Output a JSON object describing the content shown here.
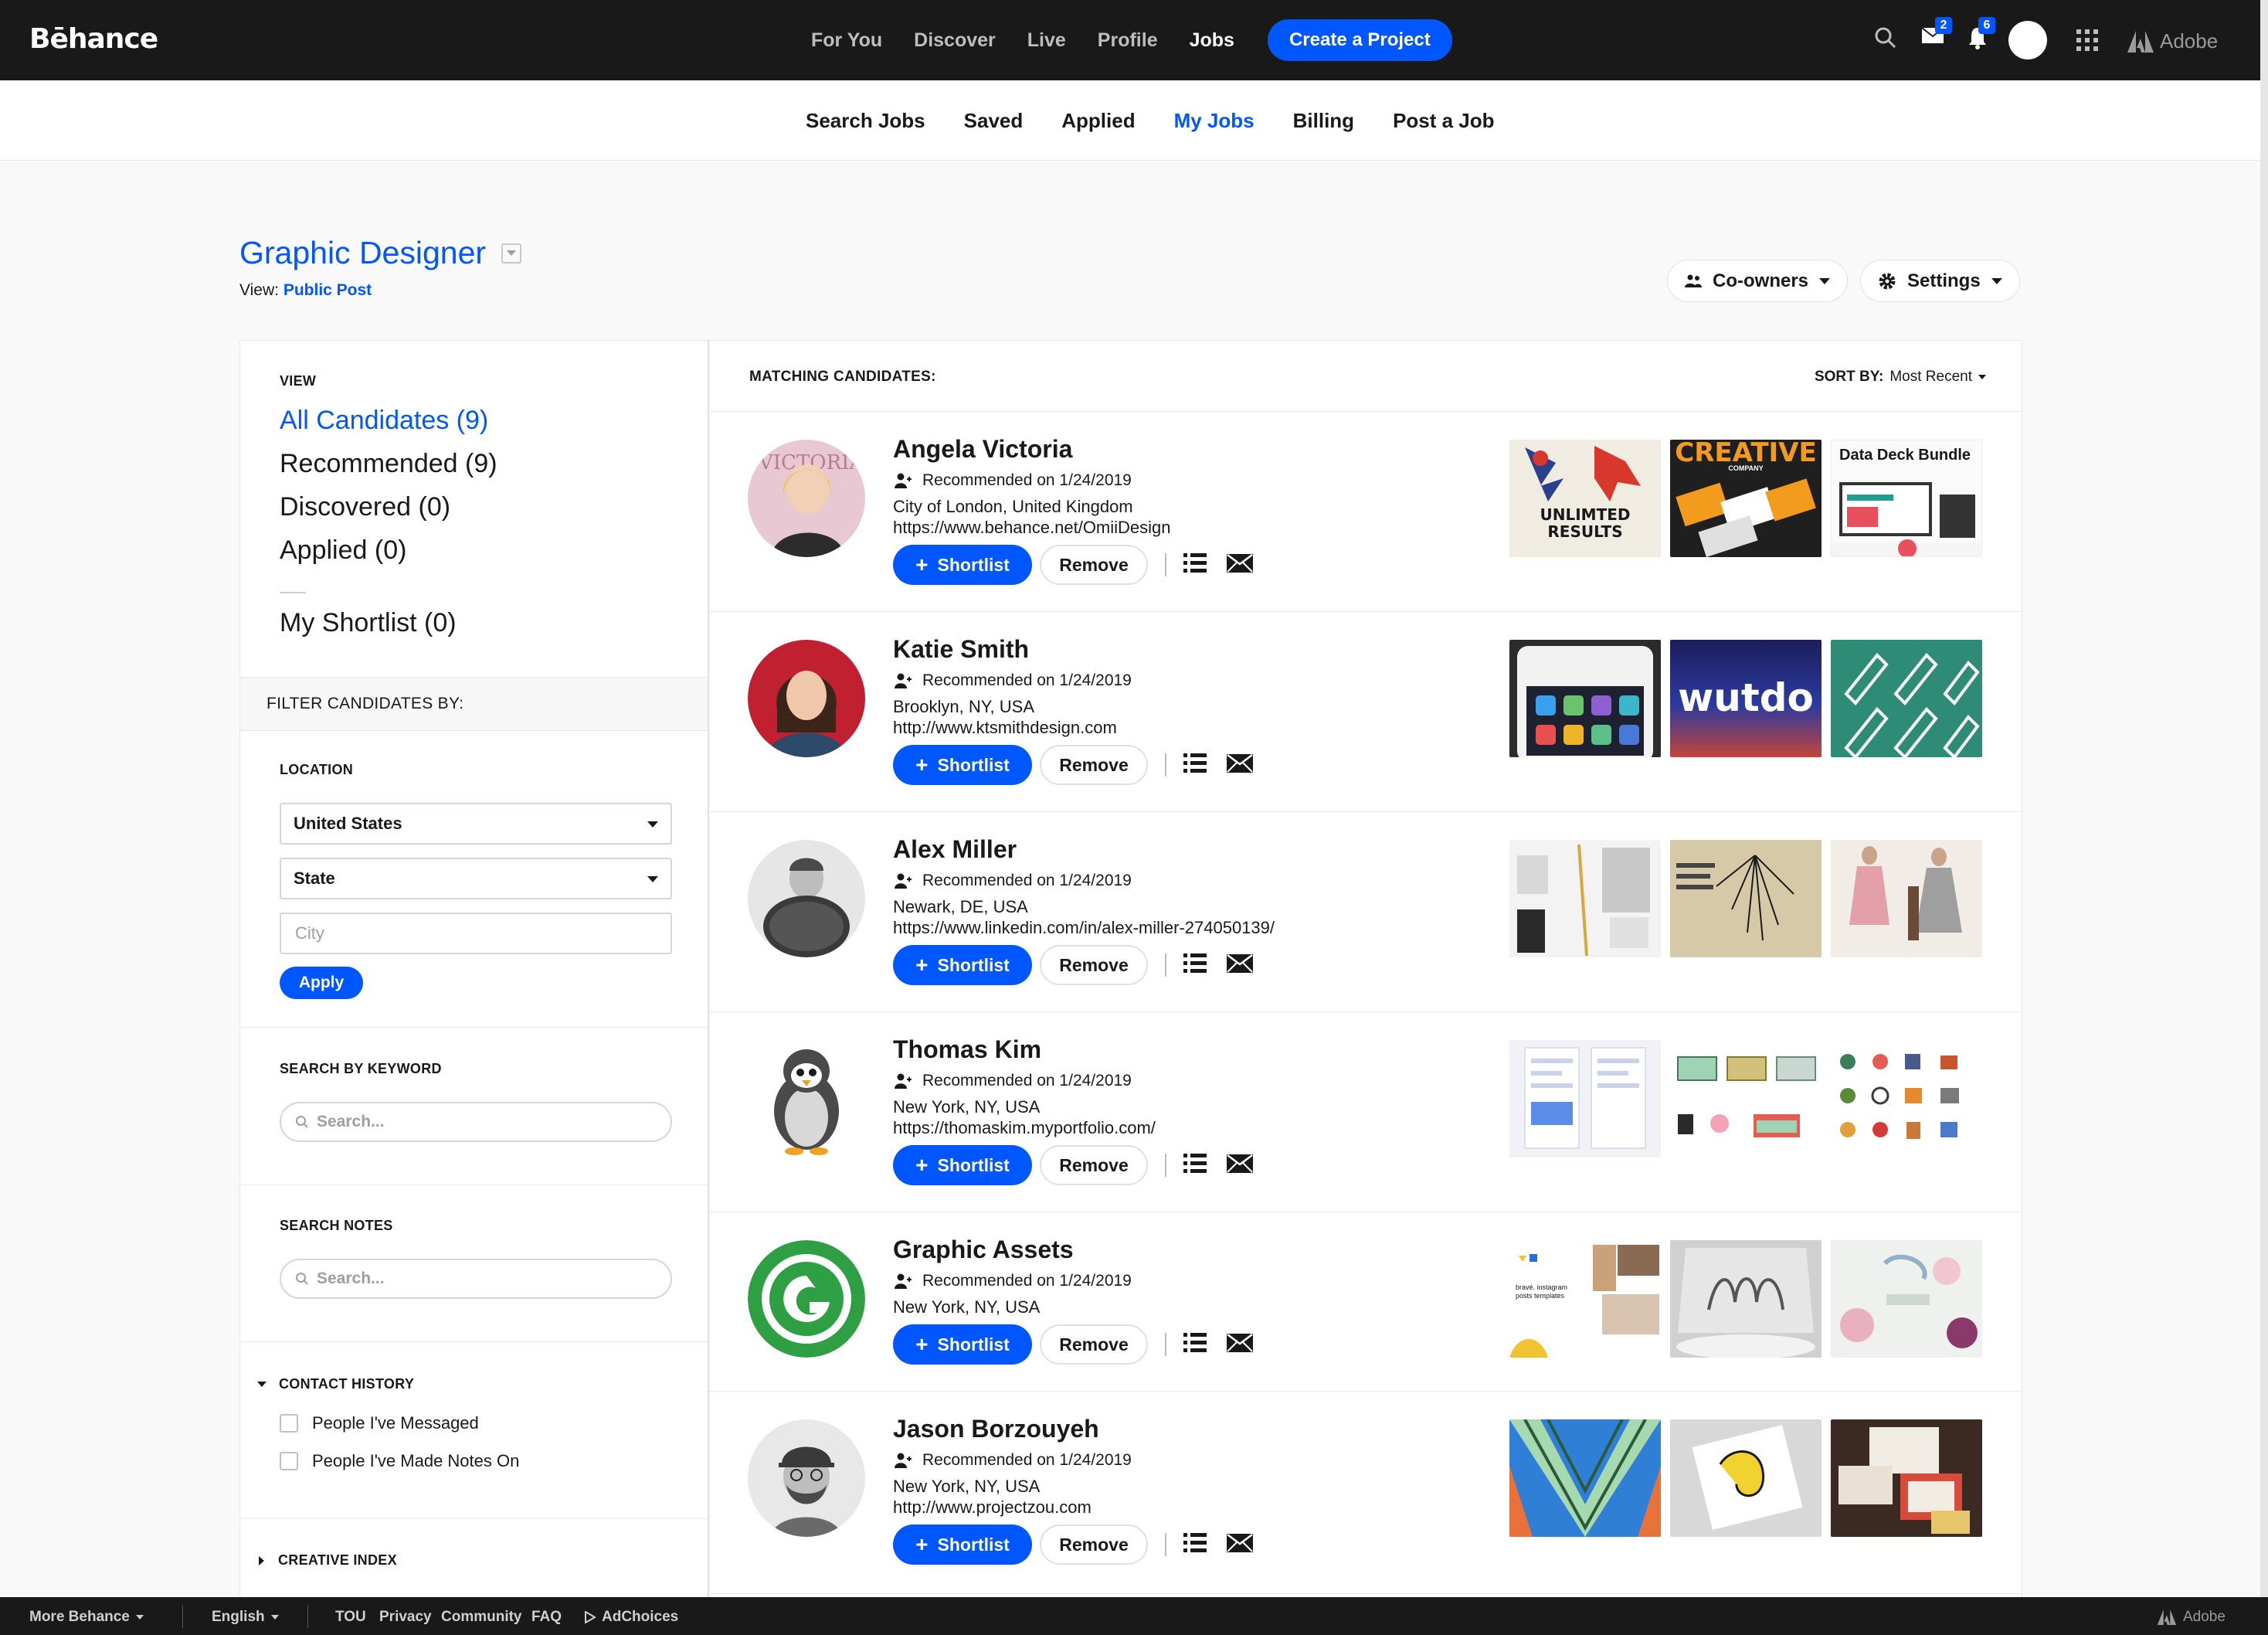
{
  "brand": {
    "logo": "Bēhance",
    "adobe": "Adobe"
  },
  "topnav": {
    "items": [
      "For You",
      "Discover",
      "Live",
      "Profile",
      "Jobs"
    ],
    "active": "Jobs",
    "create_label": "Create a Project",
    "messages_badge": "2",
    "notifications_badge": "6"
  },
  "subnav": {
    "items": [
      "Search Jobs",
      "Saved",
      "Applied",
      "My Jobs",
      "Billing",
      "Post a Job"
    ],
    "active": "My Jobs"
  },
  "job": {
    "title": "Graphic Designer",
    "view_label": "View:",
    "view_value": "Public Post",
    "coowners_label": "Co-owners",
    "settings_label": "Settings"
  },
  "sidebar": {
    "view_heading": "VIEW",
    "views": [
      {
        "label": "All Candidates (9)",
        "active": true
      },
      {
        "label": "Recommended (9)",
        "active": false
      },
      {
        "label": "Discovered (0)",
        "active": false
      },
      {
        "label": "Applied (0)",
        "active": false
      },
      {
        "label": "My Shortlist (0)",
        "active": false
      }
    ],
    "filter_heading": "FILTER CANDIDATES BY:",
    "location_heading": "LOCATION",
    "country": "United States",
    "state": "State",
    "city_placeholder": "City",
    "apply_label": "Apply",
    "keyword_heading": "SEARCH BY KEYWORD",
    "keyword_placeholder": "Search...",
    "notes_heading": "SEARCH NOTES",
    "notes_placeholder": "Search...",
    "contact_heading": "CONTACT HISTORY",
    "contact_options": [
      "People I've Messaged",
      "People I've Made Notes On"
    ],
    "creative_heading": "CREATIVE INDEX"
  },
  "list": {
    "heading": "MATCHING CANDIDATES:",
    "sort_label": "SORT BY:",
    "sort_value": "Most Recent",
    "shortlist_label": "Shortlist",
    "remove_label": "Remove",
    "candidates": [
      {
        "name": "Angela Victoria",
        "recommended": "Recommended on 1/24/2019",
        "location": "City of London, United Kingdom",
        "url": "https://www.behance.net/OmiiDesign",
        "thumb_text": [
          "UNLIMTED RESULTS",
          "CREATIVE",
          "COMPANY",
          "Data Deck Bundle"
        ]
      },
      {
        "name": "Katie Smith",
        "recommended": "Recommended on 1/24/2019",
        "location": "Brooklyn, NY, USA",
        "url": "http://www.ktsmithdesign.com",
        "thumb_text": [
          "wutdo"
        ]
      },
      {
        "name": "Alex Miller",
        "recommended": "Recommended on 1/24/2019",
        "location": "Newark, DE, USA",
        "url": "https://www.linkedin.com/in/alex-miller-274050139/",
        "thumb_text": []
      },
      {
        "name": "Thomas Kim",
        "recommended": "Recommended on 1/24/2019",
        "location": "New York, NY, USA",
        "url": "https://thomaskim.myportfolio.com/",
        "thumb_text": []
      },
      {
        "name": "Graphic Assets",
        "recommended": "Recommended on 1/24/2019",
        "location": "New York, NY, USA",
        "url": "",
        "thumb_text": [
          "bravé. instagram posts templates"
        ]
      },
      {
        "name": "Jason Borzouyeh",
        "recommended": "Recommended on 1/24/2019",
        "location": "New York, NY, USA",
        "url": "http://www.projectzou.com",
        "thumb_text": []
      }
    ]
  },
  "footer": {
    "more": "More Behance",
    "language": "English",
    "links": [
      "TOU",
      "Privacy",
      "Community",
      "FAQ"
    ],
    "adchoices": "AdChoices",
    "adobe": "Adobe"
  },
  "colors": {
    "accent": "#0057ff",
    "topbar": "#191919"
  }
}
